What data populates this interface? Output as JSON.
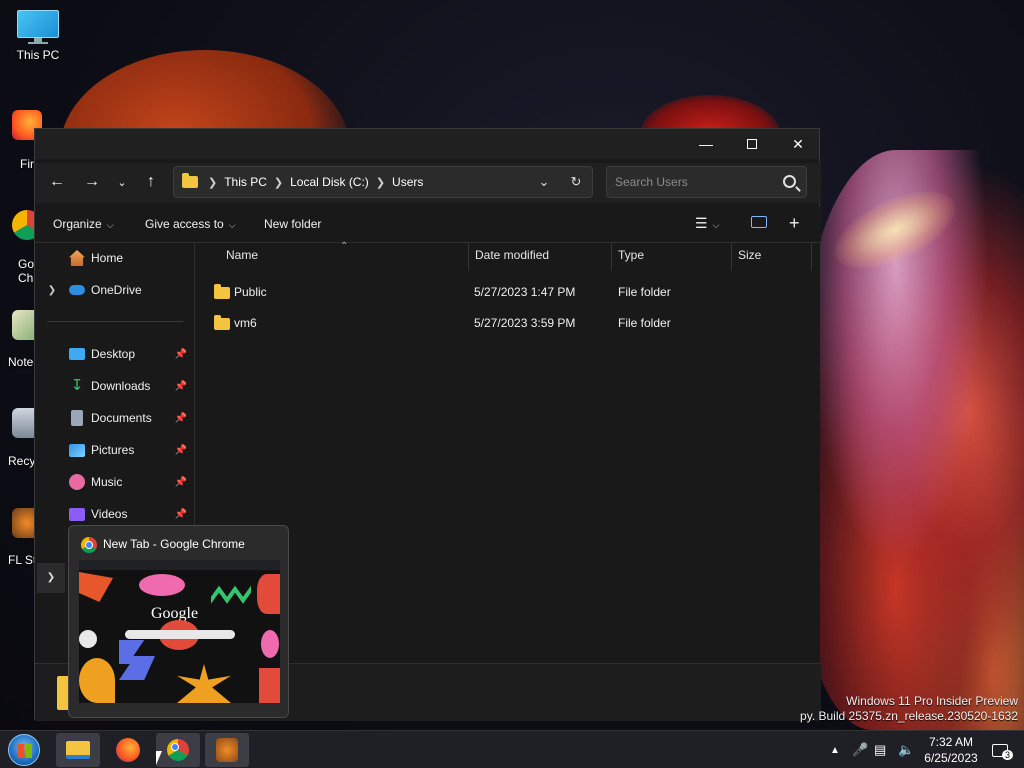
{
  "desktop": {
    "icons": [
      {
        "label": "This PC"
      },
      {
        "label": "Fir"
      },
      {
        "label": "Go\nChr"
      },
      {
        "label": "Note"
      },
      {
        "label": "Recy"
      },
      {
        "label": "FL St"
      }
    ]
  },
  "explorer": {
    "address": {
      "crumbs": [
        "This PC",
        "Local Disk (C:)",
        "Users"
      ]
    },
    "search": {
      "placeholder": "Search Users"
    },
    "toolbar": {
      "organize": "Organize",
      "give_access": "Give access to",
      "new_folder": "New folder"
    },
    "nav": {
      "home": "Home",
      "onedrive": "OneDrive",
      "quick": [
        {
          "label": "Desktop",
          "color": "#3fa9f5"
        },
        {
          "label": "Downloads",
          "color": "#2ecc71"
        },
        {
          "label": "Documents",
          "color": "#9aa7b8"
        },
        {
          "label": "Pictures",
          "color": "#2f93e6"
        },
        {
          "label": "Music",
          "color": "#e86aa0"
        },
        {
          "label": "Videos",
          "color": "#8b5cf6"
        }
      ]
    },
    "columns": [
      "Name",
      "Date modified",
      "Type",
      "Size"
    ],
    "files": [
      {
        "name": "Public",
        "date": "5/27/2023 1:47 PM",
        "type": "File folder",
        "size": ""
      },
      {
        "name": "vm6",
        "date": "5/27/2023 3:59 PM",
        "type": "File folder",
        "size": ""
      }
    ]
  },
  "preview": {
    "title": "New Tab - Google Chrome",
    "google_text": "Google"
  },
  "taskbar": {
    "time": "7:32 AM",
    "date": "6/25/2023",
    "notification_count": "3"
  },
  "watermark": {
    "line1": "Windows 11 Pro Insider Preview",
    "line2": "py. Build 25375.zn_release.230520-1632"
  },
  "colors": {
    "accent": "#f3c43f",
    "window_bg": "#191919",
    "taskbar_bg": "#1f1f26"
  }
}
